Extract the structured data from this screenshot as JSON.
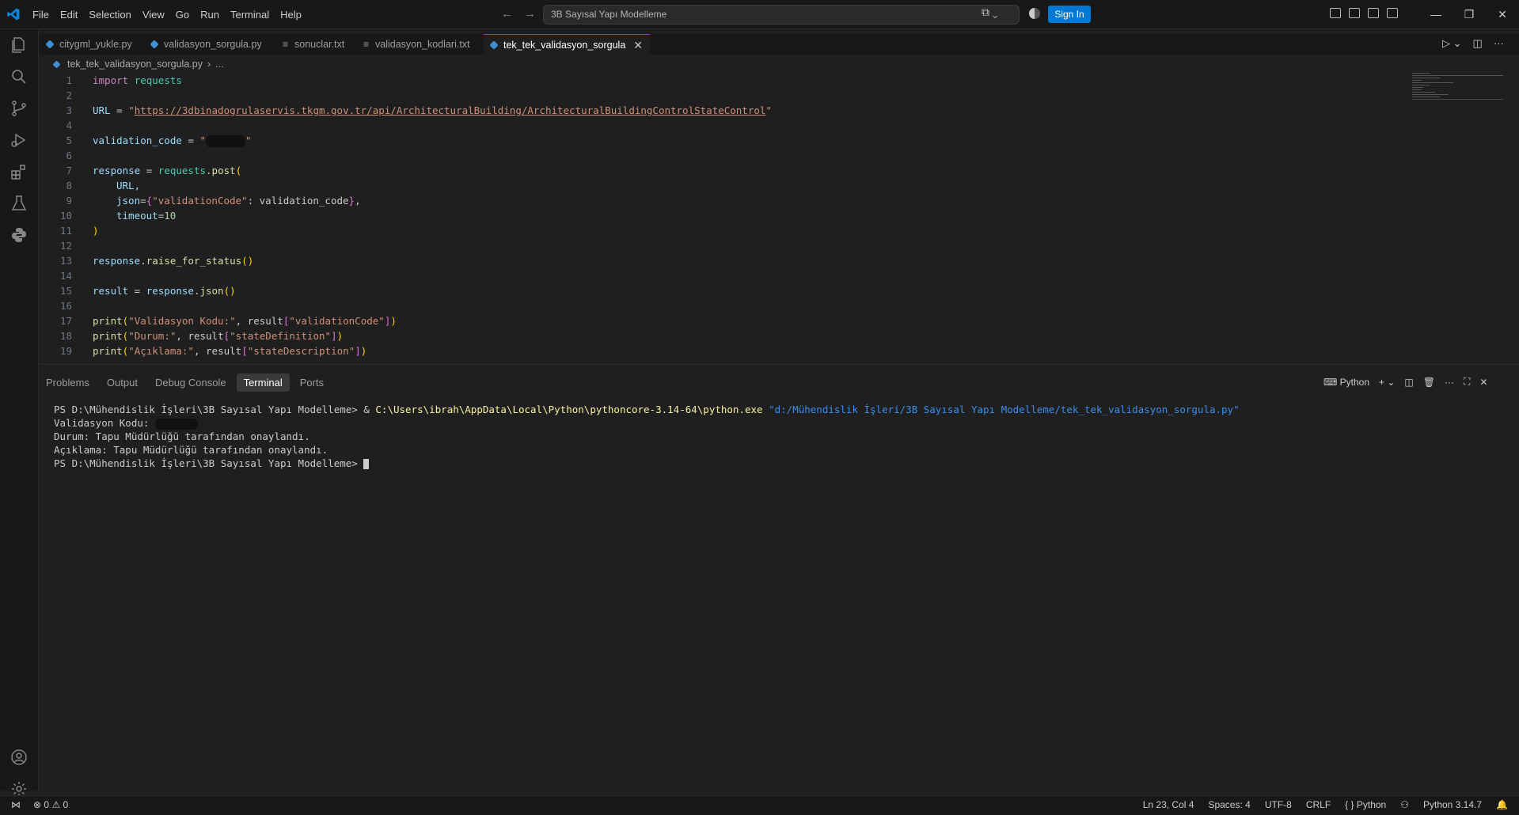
{
  "menu": [
    "File",
    "Edit",
    "Selection",
    "View",
    "Go",
    "Run",
    "Terminal",
    "Help"
  ],
  "command_center": "3B Sayısal Yapı Modelleme",
  "sign_in": "Sign In",
  "tabs": [
    {
      "label": "citygml_yukle.py"
    },
    {
      "label": "validasyon_sorgula.py"
    },
    {
      "label": "sonuclar.txt"
    },
    {
      "label": "validasyon_kodlari.txt"
    },
    {
      "label": "tek_tek_validasyon_sorgula"
    }
  ],
  "breadcrumb": {
    "file": "tek_tek_validasyon_sorgula.py",
    "rest": "..."
  },
  "line_numbers": [
    "1",
    "2",
    "3",
    "4",
    "5",
    "6",
    "7",
    "8",
    "9",
    "10",
    "11",
    "12",
    "13",
    "14",
    "15",
    "16",
    "17",
    "18",
    "19"
  ],
  "code": {
    "l1_kw": "import",
    "l1_mod": "requests",
    "l3_var": "URL",
    "l3_eq": " = ",
    "l3_q": "\"",
    "l3_url": "https://3dbinadogrulaservis.tkgm.gov.tr/api/ArchitecturalBuilding/ArchitecturalBuildingControlStateControl",
    "l5_var": "validation_code",
    "l5_eq": " = ",
    "l5_q": "\"",
    "l7_var": "response",
    "l7_eq": " = ",
    "l7_mod": "requests",
    "l7_fn": "post",
    "l8": "URL,",
    "l9_key": "json",
    "l9_str": "\"validationCode\"",
    "l9_val": ": validation_code",
    "l9_end": ",",
    "l10_key": "timeout",
    "l10_num": "10",
    "l11": ")",
    "l13_var": "response",
    "l13_fn": "raise_for_status",
    "l15_var": "result",
    "l15_eq": " = ",
    "l15_var2": "response",
    "l15_fn": "json",
    "l17_fn": "print",
    "l17_str": "\"Validasyon Kodu:\"",
    "l17_mid": ", result",
    "l17_key": "\"validationCode\"",
    "l18_fn": "print",
    "l18_str": "\"Durum:\"",
    "l18_mid": ", result",
    "l18_key": "\"stateDefinition\"",
    "l19_fn": "print",
    "l19_str": "\"Açıklama:\"",
    "l19_mid": ", result",
    "l19_key": "\"stateDescription\""
  },
  "panel_tabs": [
    "Problems",
    "Output",
    "Debug Console",
    "Terminal",
    "Ports"
  ],
  "terminal_profile": "Python",
  "terminal": {
    "prompt": "PS D:\\Mühendislik İşleri\\3B Sayısal Yapı Modelleme>",
    "cmd_amp": " & ",
    "cmd_exe": "C:\\Users\\ibrah\\AppData\\Local\\Python\\pythoncore-3.14-64\\python.exe",
    "cmd_arg": " \"d:/Mühendislik İşleri/3B Sayısal Yapı Modelleme/tek_tek_validasyon_sorgula.py\"",
    "out1": "Validasyon Kodu: ",
    "out2": "Durum: Tapu Müdürlüğü tarafından onaylandı.",
    "out3": "Açıklama: Tapu Müdürlüğü tarafından onaylandı.",
    "prompt2": "PS D:\\Mühendislik İşleri\\3B Sayısal Yapı Modelleme> "
  },
  "status": {
    "errors": "0",
    "warnings": "0",
    "position": "Ln 23, Col 4",
    "spaces": "Spaces: 4",
    "encoding": "UTF-8",
    "eol": "CRLF",
    "language": "Python",
    "interpreter": "Python 3.14.7"
  }
}
